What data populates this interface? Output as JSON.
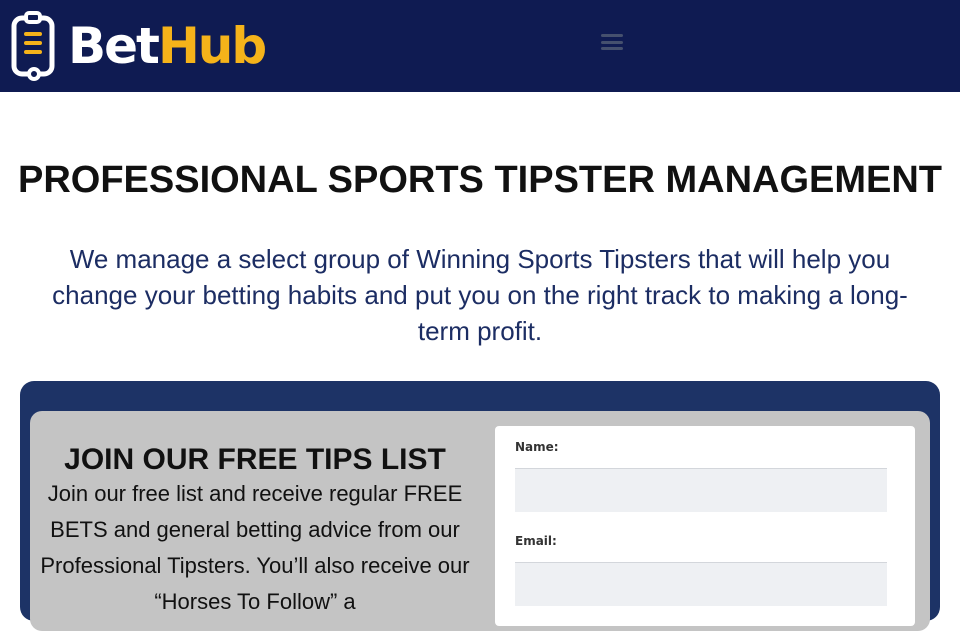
{
  "header": {
    "logo_part1": "Bet",
    "logo_part2": "Hub",
    "menu_icon": "hamburger-menu-icon",
    "colors": {
      "background": "#0f1b52",
      "accent": "#f5b31a"
    }
  },
  "hero": {
    "title": "PROFESSIONAL SPORTS TIPSTER MANAGEMENT",
    "subtitle": "We manage a select group of Winning Sports Tipsters that will help you change your betting habits and put you on the right track to making a long-term profit."
  },
  "signup": {
    "title": "JOIN OUR FREE TIPS LIST",
    "text": "Join our free list and receive regular FREE BETS and general betting advice from our Professional Tipsters. You’ll also receive our “Horses To Follow” a",
    "form": {
      "name_label": "Name:",
      "name_value": "",
      "email_label": "Email:",
      "email_value": ""
    }
  }
}
